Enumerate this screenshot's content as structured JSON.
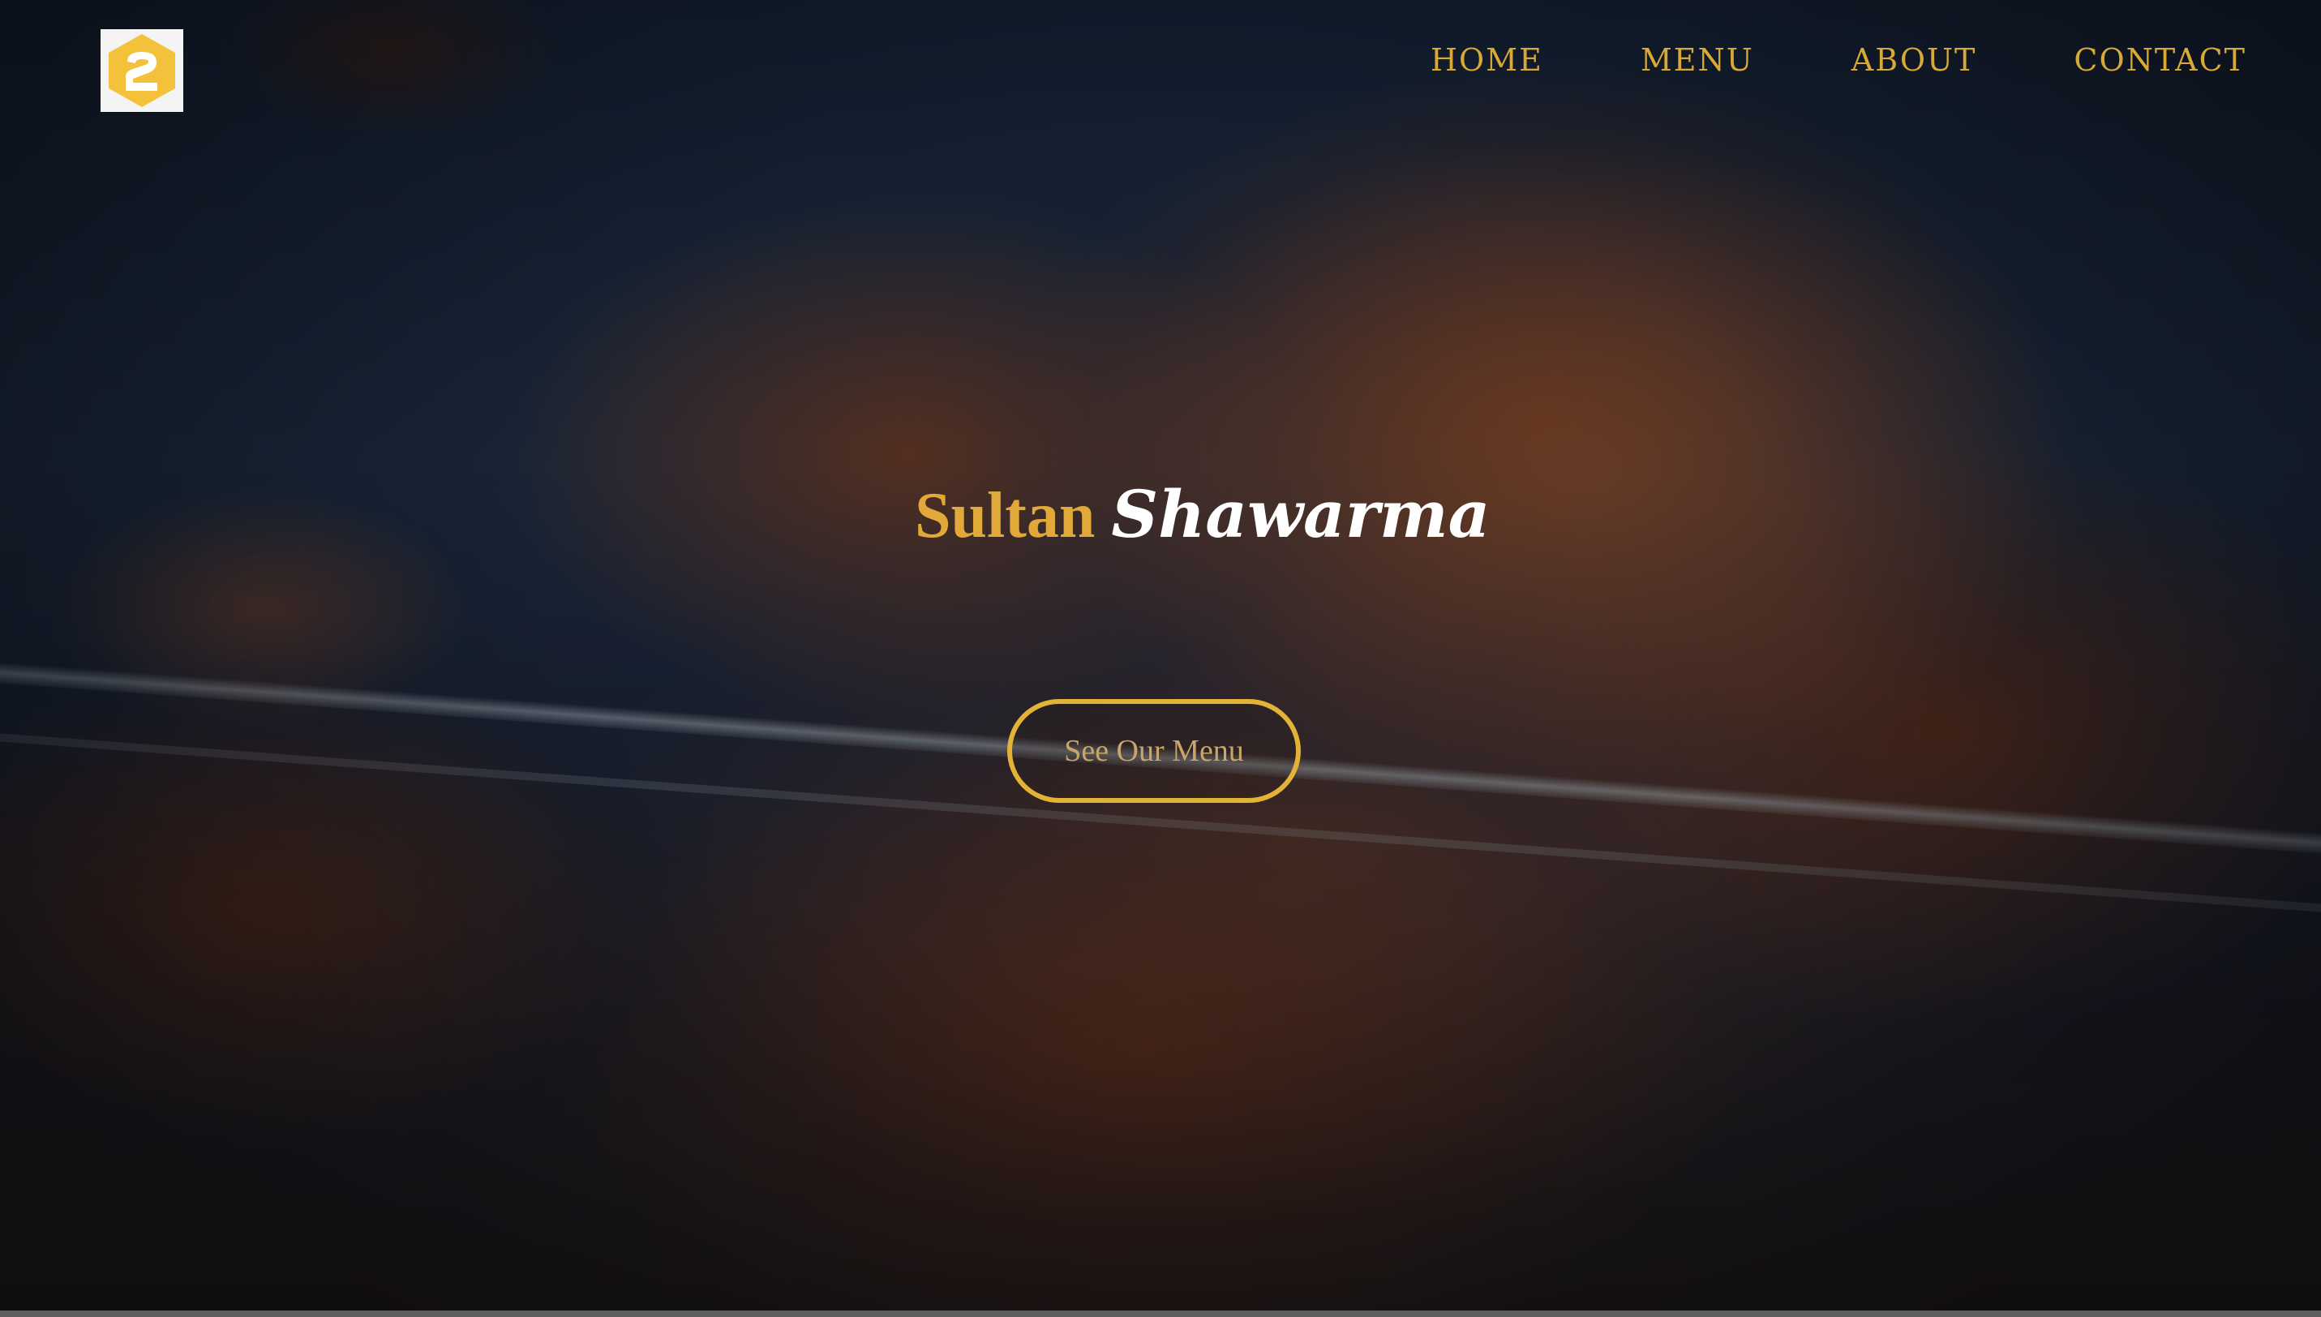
{
  "brand": {
    "logo_icon": "hexagon-2-logo-icon",
    "logo_color": "#F3C23A"
  },
  "nav": {
    "items": [
      {
        "label": "HOME"
      },
      {
        "label": "MENU"
      },
      {
        "label": "ABOUT"
      },
      {
        "label": "CONTACT"
      }
    ],
    "color": "#D9A937"
  },
  "hero": {
    "title_part1": "Sultan",
    "title_part2": "Shawarma",
    "cta_label": "See Our Menu",
    "accent_color": "#E3B338",
    "background": "shawarma-meat-photo"
  }
}
